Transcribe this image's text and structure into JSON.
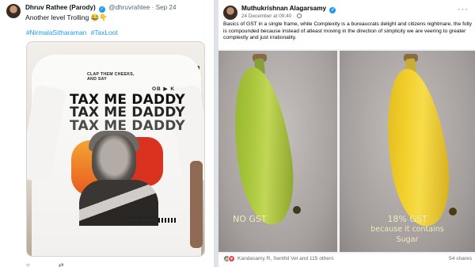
{
  "tweet": {
    "author_name": "Dhruv Rathee (Parody)",
    "handle": "@dhruvrahtee",
    "separator": "·",
    "date": "Sep 24",
    "text": "Another level Trolling 😂👇",
    "hashtags": [
      "#NirmalaSitharaman",
      "#TaxLoot"
    ],
    "shirt": {
      "top_line_1": "CLAP THEM CHEEKS,",
      "top_line_2": "AND SAY",
      "logos": "OB ▶ K",
      "tax_line": "TAX ME DADDY",
      "bottom_line_1": "F*CK THE MIDDLE",
      "bottom_line_2": "CLASS SEASON 2"
    },
    "colors": {
      "link": "#1d9bf0",
      "verified": "#1d9bf0"
    }
  },
  "facebook": {
    "author_name": "Muthukrishnan Alagarsamy",
    "date": "24 December at 09:40 ·",
    "more_icon": "···",
    "text": "Basics of GST in a single frame, while Complexity is a bureaucrats delight and citizens nightmare, the folly is compounded because instead of atleast moving in the direction of simplicity we are veering to greater complexity and just irrationality.",
    "left_caption": "NO GST",
    "right_caption_1": "18% GST",
    "right_caption_2": "because it contains",
    "right_caption_3": "Sugar",
    "reactions_text": "Kandasamy R, Senthil Vel and 115 others",
    "shares": "54 shares",
    "colors": {
      "like": "#1877f2",
      "love": "#f33e58"
    }
  }
}
